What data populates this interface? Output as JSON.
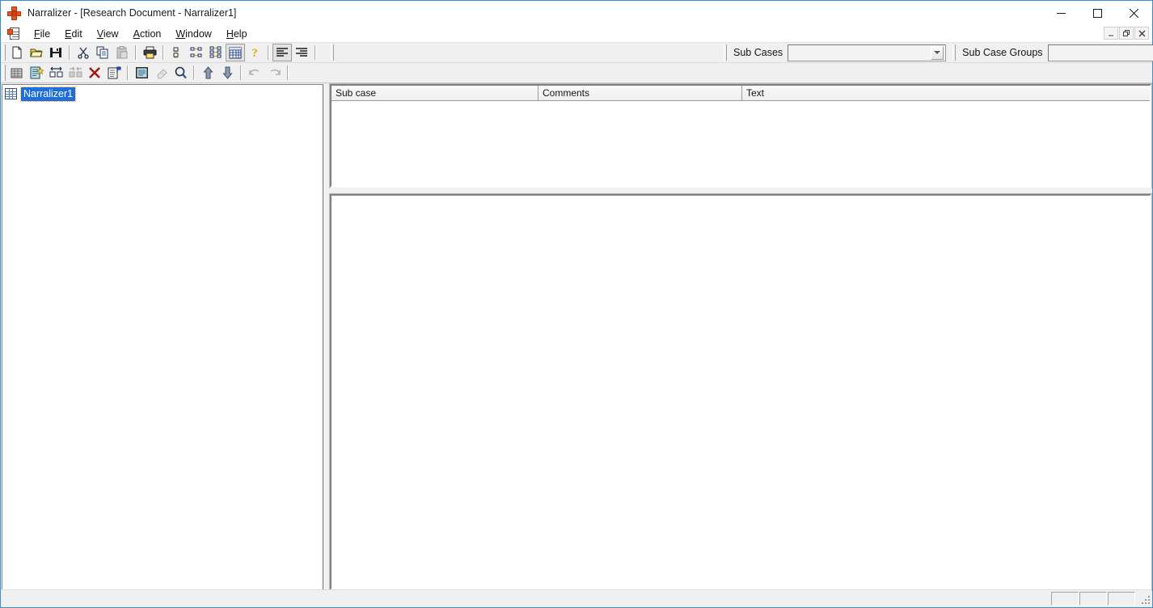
{
  "window": {
    "title": "Narralizer - [Research Document - Narralizer1]",
    "app_icon": "narralizer-app-icon",
    "minimize_label": "Minimize",
    "maximize_label": "Maximize",
    "close_label": "Close",
    "accent_color": "#3a8fd0",
    "icon_color": "#e8541b"
  },
  "mdi": {
    "icon": "document-icon",
    "restore_label": "Restore",
    "minimize_label": "Minimize",
    "close_label": "Close"
  },
  "menu": {
    "items": [
      {
        "label": "File",
        "accel": "F"
      },
      {
        "label": "Edit",
        "accel": "E"
      },
      {
        "label": "View",
        "accel": "V"
      },
      {
        "label": "Action",
        "accel": "A"
      },
      {
        "label": "Window",
        "accel": "W"
      },
      {
        "label": "Help",
        "accel": "H"
      }
    ]
  },
  "toolbar_main": {
    "buttons": [
      {
        "icon": "new-document-icon",
        "tooltip": "New",
        "enabled": true,
        "pressed": false
      },
      {
        "icon": "open-folder-icon",
        "tooltip": "Open",
        "enabled": true,
        "pressed": false
      },
      {
        "icon": "save-disk-icon",
        "tooltip": "Save",
        "enabled": true,
        "pressed": false
      },
      {
        "icon": "cut-scissors-icon",
        "tooltip": "Cut",
        "enabled": true,
        "pressed": false
      },
      {
        "icon": "copy-icon",
        "tooltip": "Copy",
        "enabled": true,
        "pressed": false
      },
      {
        "icon": "paste-icon",
        "tooltip": "Paste",
        "enabled": false,
        "pressed": false
      },
      {
        "icon": "print-icon",
        "tooltip": "Print",
        "enabled": true,
        "pressed": false
      },
      {
        "icon": "hierarchy-vertical-icon",
        "tooltip": "Hierarchy",
        "enabled": true,
        "pressed": false
      },
      {
        "icon": "hierarchy-branch-icon",
        "tooltip": "Branch view",
        "enabled": true,
        "pressed": false
      },
      {
        "icon": "hierarchy-tree-icon",
        "tooltip": "Tree view",
        "enabled": true,
        "pressed": false
      },
      {
        "icon": "grid-view-icon",
        "tooltip": "Grid view",
        "enabled": true,
        "pressed": true
      },
      {
        "icon": "help-question-icon",
        "tooltip": "Help",
        "enabled": true,
        "pressed": false
      },
      {
        "icon": "align-left-icon",
        "tooltip": "Align left",
        "enabled": true,
        "pressed": true
      },
      {
        "icon": "align-right-icon",
        "tooltip": "Align right",
        "enabled": true,
        "pressed": false
      }
    ]
  },
  "toolbar_action": {
    "buttons": [
      {
        "icon": "grid-small-icon",
        "tooltip": "Grid",
        "enabled": true,
        "pressed": false
      },
      {
        "icon": "new-subcase-icon",
        "tooltip": "New sub case",
        "enabled": true,
        "pressed": false
      },
      {
        "icon": "expand-icon",
        "tooltip": "Expand",
        "enabled": true,
        "pressed": false
      },
      {
        "icon": "collapse-icon",
        "tooltip": "Collapse",
        "enabled": false,
        "pressed": false
      },
      {
        "icon": "delete-x-icon",
        "tooltip": "Delete",
        "enabled": true,
        "pressed": false
      },
      {
        "icon": "properties-icon",
        "tooltip": "Properties",
        "enabled": true,
        "pressed": false
      },
      {
        "icon": "document-view-icon",
        "tooltip": "Document view",
        "enabled": true,
        "pressed": false
      },
      {
        "icon": "eraser-icon",
        "tooltip": "Erase",
        "enabled": false,
        "pressed": false
      },
      {
        "icon": "search-magnifier-icon",
        "tooltip": "Search",
        "enabled": true,
        "pressed": false
      },
      {
        "icon": "arrow-up-icon",
        "tooltip": "Move up",
        "enabled": true,
        "pressed": false
      },
      {
        "icon": "arrow-down-icon",
        "tooltip": "Move down",
        "enabled": true,
        "pressed": false
      },
      {
        "icon": "undo-icon",
        "tooltip": "Undo",
        "enabled": false,
        "pressed": false
      },
      {
        "icon": "redo-icon",
        "tooltip": "Redo",
        "enabled": false,
        "pressed": false
      }
    ]
  },
  "sub_cases": {
    "label": "Sub Cases",
    "value": "",
    "placeholder": "",
    "dropdown_icon": "chevron-down-icon"
  },
  "sub_case_groups": {
    "label": "Sub Case Groups",
    "value": "",
    "placeholder": "",
    "dropdown_icon": "chevron-down-icon"
  },
  "tree": {
    "items": [
      {
        "label": "Narralizer1",
        "icon": "grid-node-icon",
        "selected": true
      }
    ]
  },
  "grid": {
    "columns": [
      {
        "label": "Sub case"
      },
      {
        "label": "Comments"
      },
      {
        "label": "Text"
      }
    ],
    "rows": []
  },
  "text_pane": {
    "content": ""
  },
  "statusbar": {
    "message": "",
    "panels": [
      "",
      "",
      ""
    ],
    "resize_grip": "resize-grip-icon"
  }
}
